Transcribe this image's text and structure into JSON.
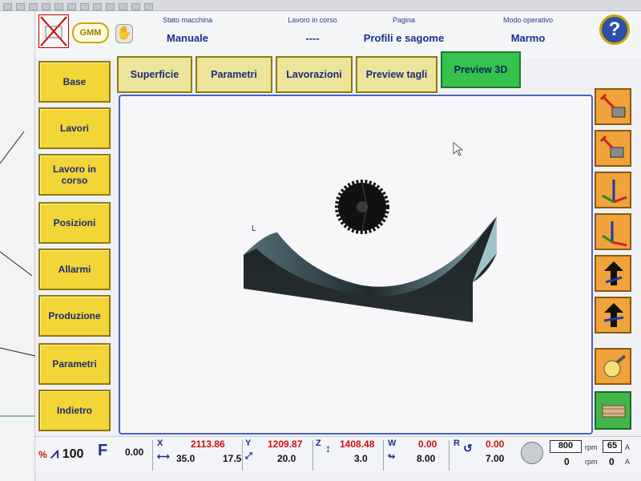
{
  "header": {
    "machine_state_label": "Stato macchina",
    "machine_state_value": "Manuale",
    "job_label": "Lavoro in corso",
    "job_value": "----",
    "page_label": "Pagina",
    "page_value": "Profili e sagome",
    "mode_label": "Modo operativo",
    "mode_value": "Marmo",
    "logo_text": "GMM",
    "help_label": "?"
  },
  "leftnav": {
    "items": [
      {
        "label": "Base"
      },
      {
        "label": "Lavori"
      },
      {
        "label": "Lavoro in corso"
      },
      {
        "label": "Posizioni"
      },
      {
        "label": "Allarmi"
      },
      {
        "label": "Produzione"
      },
      {
        "label": "Parametri"
      },
      {
        "label": "Indietro"
      }
    ]
  },
  "tabs": [
    {
      "label": "Superficie"
    },
    {
      "label": "Parametri"
    },
    {
      "label": "Lavorazioni"
    },
    {
      "label": "Preview tagli"
    },
    {
      "label": "Preview 3D",
      "active": true
    }
  ],
  "viewport": {
    "axis_marker": "L"
  },
  "righttools": [
    {
      "icon": "tool-change-icon"
    },
    {
      "icon": "tool-remove-icon"
    },
    {
      "icon": "axis-view-front-icon"
    },
    {
      "icon": "axis-view-iso-icon"
    },
    {
      "icon": "move-up-icon"
    },
    {
      "icon": "move-up-alt-icon"
    },
    {
      "icon": "lamp-icon"
    },
    {
      "icon": "slab-icon"
    }
  ],
  "status": {
    "feed_percent_icon": "%",
    "feed_value": "100",
    "f_label": "F",
    "f_value": "0.00",
    "x_label": "X",
    "x_pos": "2113.86",
    "x_sub1": "35.0",
    "x_sub2": "17.5",
    "y_label": "Y",
    "y_pos": "1209.87",
    "y_sub": "20.0",
    "z_label": "Z",
    "z_pos": "1408.48",
    "z_sub": "3.0",
    "w_label": "W",
    "w_pos": "0.00",
    "w_sub": "8.00",
    "r_label": "R",
    "r_pos": "0.00",
    "r_sub": "7.00",
    "rpm_set": "800",
    "rpm_actual": "0",
    "rpm_unit": "rpm",
    "amp_set": "65",
    "amp_actual": "0",
    "amp_unit": "A"
  },
  "colors": {
    "nav_yellow": "#f2d536",
    "tab_active_green": "#35c24e",
    "accent_blue": "#1e2a78",
    "tool_orange": "#f0a33a"
  }
}
